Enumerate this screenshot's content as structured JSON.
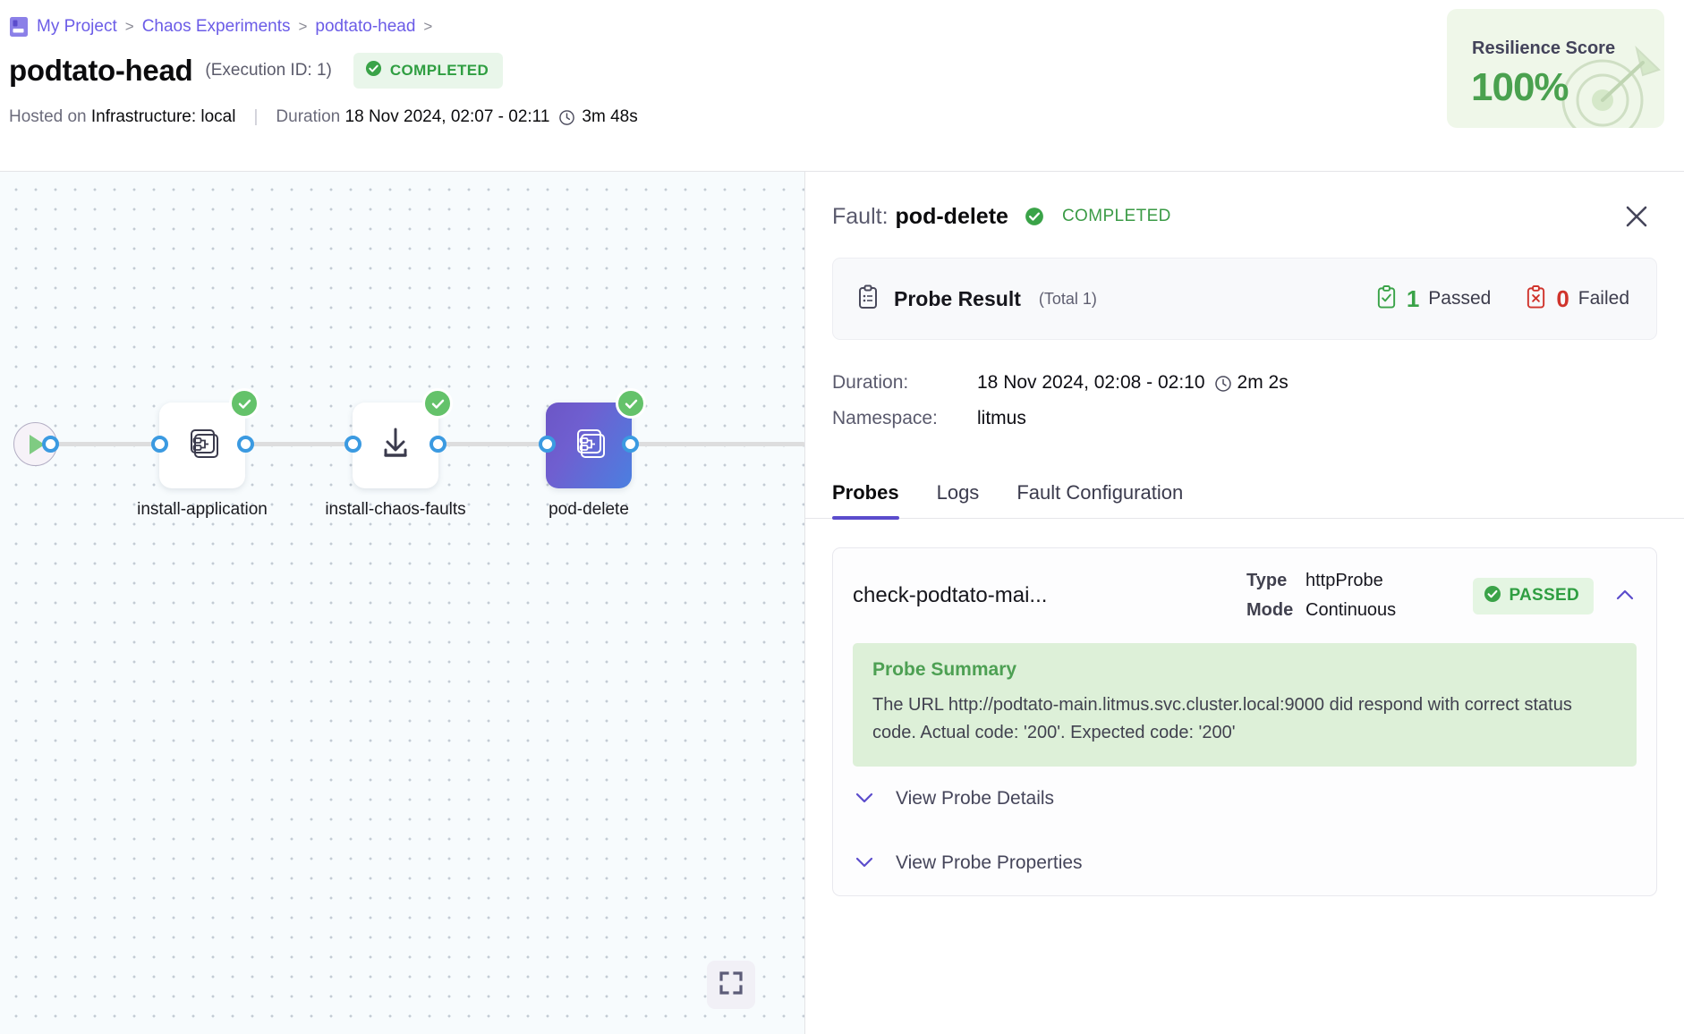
{
  "breadcrumb": {
    "icon": "project-icon",
    "items": [
      "My Project",
      "Chaos Experiments",
      "podtato-head"
    ],
    "separator": ">"
  },
  "header": {
    "title": "podtato-head",
    "execution_id": "(Execution ID: 1)",
    "status": "COMPLETED",
    "status_icon": "check-circle-icon",
    "hosted_on_label": "Hosted on",
    "hosted_on_value": "Infrastructure: local",
    "divider": "|",
    "duration_label": "Duration",
    "duration_value": "18 Nov 2024, 02:07 - 02:11",
    "duration_elapsed": "3m 48s",
    "clock_icon": "clock-icon"
  },
  "score": {
    "label": "Resilience Score",
    "value": "100%",
    "bg_color": "#eff7e9",
    "value_color": "#4aa14f",
    "art_icon": "target-arrow-icon"
  },
  "canvas": {
    "start_node": {
      "name": "start-node",
      "icon": "play-icon"
    },
    "nodes": [
      {
        "label": "install-application",
        "icon": "flow-stack-icon",
        "status_icon": "check-circle-icon",
        "selected": false
      },
      {
        "label": "install-chaos-faults",
        "icon": "download-icon",
        "status_icon": "check-circle-icon",
        "selected": false
      },
      {
        "label": "pod-delete",
        "icon": "flow-stack-icon",
        "status_icon": "check-circle-icon",
        "selected": true
      }
    ],
    "fullscreen_icon": "fullscreen-icon"
  },
  "panel": {
    "fault_label": "Fault:",
    "fault_name": "pod-delete",
    "fault_status": "COMPLETED",
    "fault_status_icon": "check-circle-icon",
    "close_icon": "close-icon",
    "probe_result": {
      "icon": "clipboard-icon",
      "title": "Probe Result",
      "total": "(Total 1)",
      "passed_count": "1",
      "passed_label": "Passed",
      "passed_icon": "clipboard-check-icon",
      "failed_count": "0",
      "failed_label": "Failed",
      "failed_icon": "clipboard-x-icon"
    },
    "details": {
      "duration_key": "Duration:",
      "duration_value": "18 Nov 2024, 02:08 - 02:10",
      "duration_elapsed": "2m 2s",
      "clock_icon": "clock-icon",
      "namespace_key": "Namespace:",
      "namespace_value": "litmus"
    },
    "tabs": [
      {
        "label": "Probes",
        "active": true
      },
      {
        "label": "Logs",
        "active": false
      },
      {
        "label": "Fault Configuration",
        "active": false
      }
    ],
    "probe": {
      "name": "check-podtato-mai...",
      "type_key": "Type",
      "type_value": "httpProbe",
      "mode_key": "Mode",
      "mode_value": "Continuous",
      "badge": "PASSED",
      "badge_icon": "check-circle-icon",
      "collapse_icon": "chevron-up-icon",
      "summary_title": "Probe Summary",
      "summary_text": "The URL http://podtato-main.litmus.svc.cluster.local:9000 did respond with correct status code. Actual code: '200'. Expected code: '200'",
      "accordions": [
        {
          "label": "View Probe Details",
          "icon": "chevron-down-icon"
        },
        {
          "label": "View Probe Properties",
          "icon": "chevron-down-icon"
        }
      ]
    }
  },
  "colors": {
    "accent": "#6b5ce7",
    "success": "#3aa348",
    "danger": "#d0342c",
    "tab_underline": "#5b4ccc"
  }
}
